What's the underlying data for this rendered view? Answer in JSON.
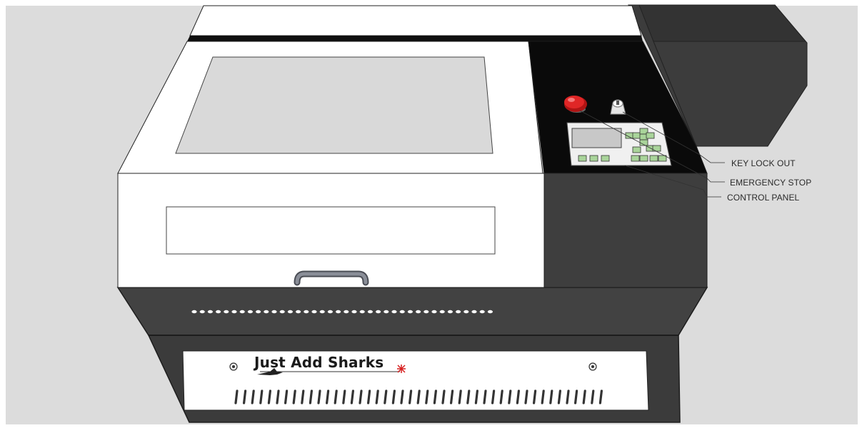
{
  "diagram": {
    "subject": "laser cutter machine",
    "colors": {
      "background": "#dcdcdc",
      "body_white": "#ffffff",
      "body_dark": "#3b3b3b",
      "panel_black": "#0a0a0a",
      "window_glass": "#d9d9d9",
      "emergency_stop": "#d71f1f",
      "control_panel_keys": "#a9d49a",
      "handle": "#7a7d86"
    },
    "brand": {
      "text": "Just Add Sharks",
      "icons": [
        "shark-logo-icon",
        "laser-burst-icon"
      ]
    },
    "callouts": [
      {
        "id": "key-lock-out",
        "label": "KEY LOCK OUT"
      },
      {
        "id": "emergency-stop",
        "label": "EMERGENCY STOP"
      },
      {
        "id": "control-panel",
        "label": "CONTROL PANEL"
      }
    ]
  }
}
